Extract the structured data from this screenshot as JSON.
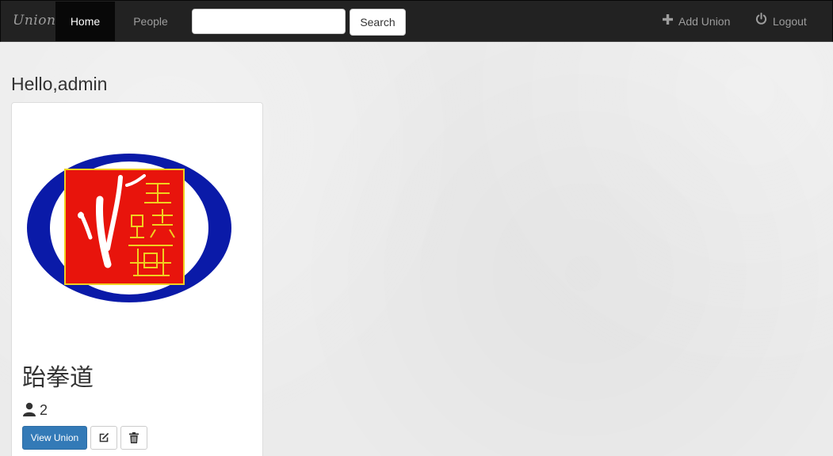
{
  "navbar": {
    "brand": "Union",
    "home_label": "Home",
    "people_label": "People",
    "search": {
      "value": "",
      "placeholder": ""
    },
    "search_button": "Search",
    "add_union_label": "Add Union",
    "add_union_icon": "plus-icon",
    "logout_label": "Logout",
    "logout_icon": "power-icon"
  },
  "greeting": "Hello,admin",
  "unions": [
    {
      "name": "跆拳道",
      "member_count": "2",
      "member_icon": "user-icon",
      "view_button": "View Union",
      "edit_icon": "edit-icon",
      "delete_icon": "trash-icon"
    }
  ],
  "colors": {
    "navbar_bg": "#222222",
    "nav_active_bg": "#080808",
    "primary_button": "#337ab7",
    "logo_ellipse": "#0a1aa8",
    "logo_seal": "#e8140c",
    "logo_seal_border": "#f0d020"
  }
}
